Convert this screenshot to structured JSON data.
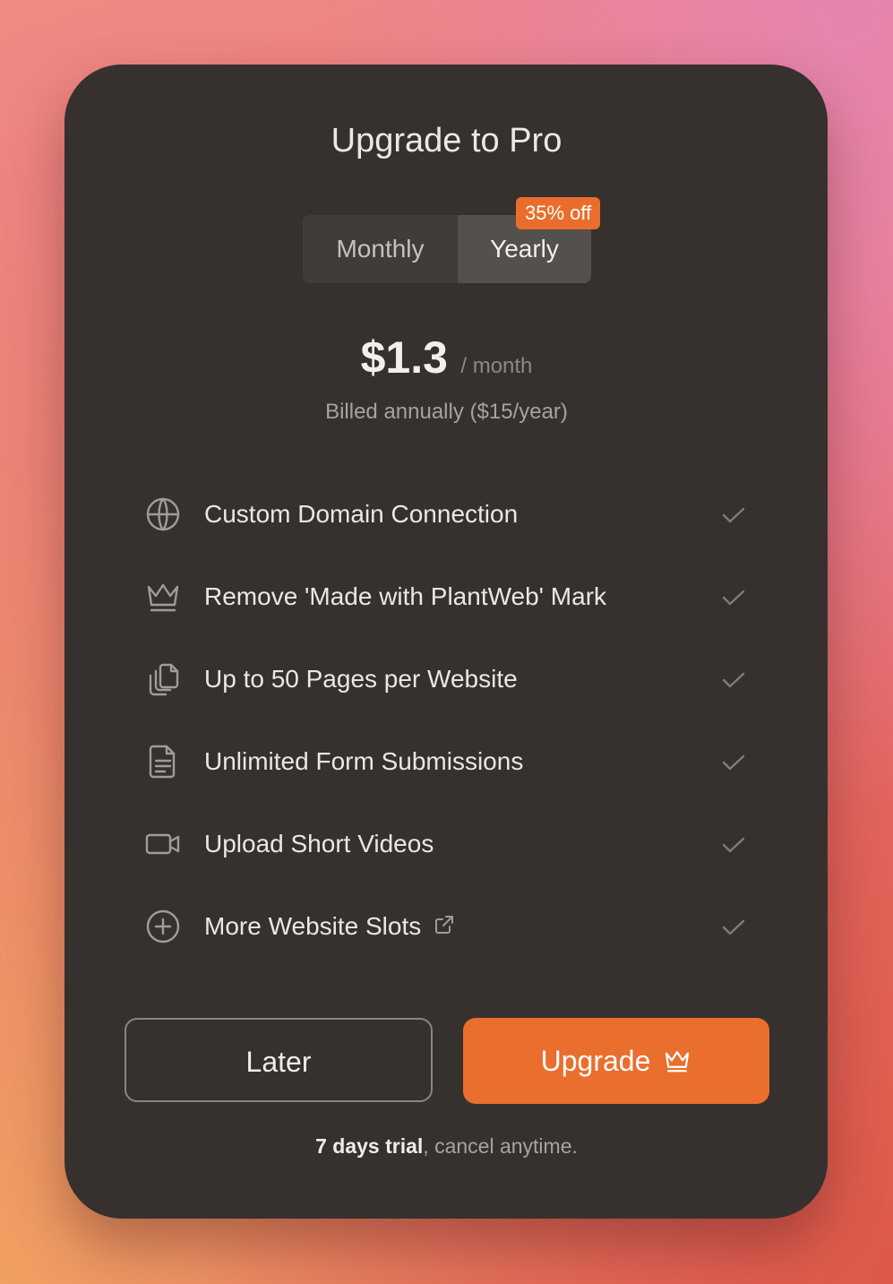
{
  "dialog": {
    "title": "Upgrade to Pro"
  },
  "billing_toggle": {
    "options": [
      "Monthly",
      "Yearly"
    ],
    "selected": "Yearly",
    "discount_badge": "35% off"
  },
  "pricing": {
    "amount": "$1.3",
    "period": "/ month",
    "billed_note": "Billed annually ($15/year)"
  },
  "features": [
    {
      "label": "Custom Domain Connection",
      "icon": "globe-icon",
      "included": true
    },
    {
      "label": "Remove 'Made with PlantWeb' Mark",
      "icon": "crown-icon",
      "included": true
    },
    {
      "label": "Up to 50 Pages per Website",
      "icon": "pages-icon",
      "included": true
    },
    {
      "label": "Unlimited Form Submissions",
      "icon": "document-icon",
      "included": true
    },
    {
      "label": "Upload Short Videos",
      "icon": "video-camera-icon",
      "included": true
    },
    {
      "label": "More Website Slots",
      "icon": "plus-circle-icon",
      "included": true,
      "external_link": true
    }
  ],
  "actions": {
    "later_label": "Later",
    "upgrade_label": "Upgrade"
  },
  "footer": {
    "trial_bold": "7 days trial",
    "trial_rest": ", cancel anytime."
  },
  "colors": {
    "card_background": "#36312f",
    "accent": "#ea6e2d",
    "text_primary": "#ebe7e2",
    "text_muted": "#a7a29d"
  }
}
